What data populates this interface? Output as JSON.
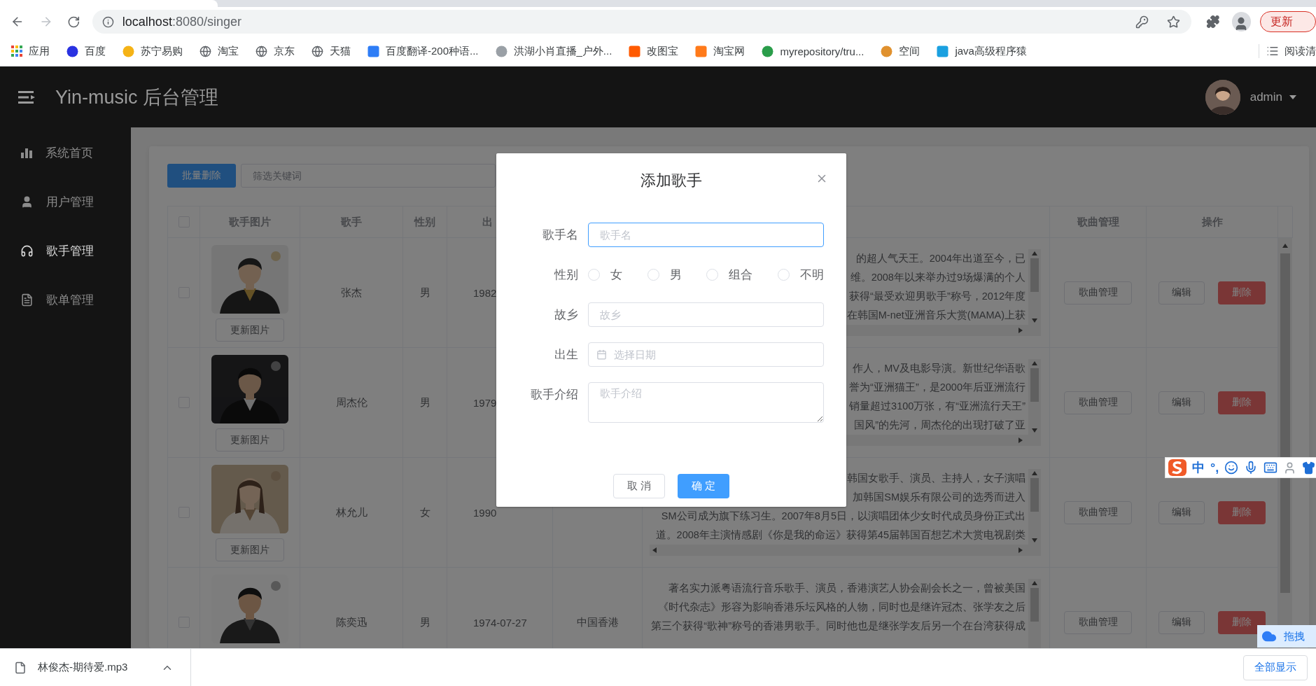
{
  "browser": {
    "url_host": "localhost",
    "url_path": ":8080/singer",
    "update_button": "更新",
    "bookmarks": [
      {
        "label": "应用",
        "kind": "apps"
      },
      {
        "label": "百度",
        "kind": "round",
        "color": "#2932e1"
      },
      {
        "label": "苏宁易购",
        "kind": "round",
        "color": "#f5b316"
      },
      {
        "label": "淘宝",
        "kind": "globe"
      },
      {
        "label": "京东",
        "kind": "globe"
      },
      {
        "label": "天猫",
        "kind": "globe"
      },
      {
        "label": "百度翻译-200种语...",
        "kind": "badge",
        "color": "#2e7df6"
      },
      {
        "label": "洪湖小肖直播_户外...",
        "kind": "round",
        "color": "#9aa0a6"
      },
      {
        "label": "改图宝",
        "kind": "badge",
        "color": "#ff5a00"
      },
      {
        "label": "淘宝网",
        "kind": "badge",
        "color": "#ff7a1a"
      },
      {
        "label": "myrepository/tru...",
        "kind": "round",
        "color": "#2a9d4a"
      },
      {
        "label": "空间",
        "kind": "round",
        "color": "#e0912e"
      },
      {
        "label": "java高级程序猿",
        "kind": "badge",
        "color": "#1aa0e0"
      }
    ],
    "reading_list": "阅读清"
  },
  "app": {
    "title": "Yin-music 后台管理",
    "user": "admin",
    "sidebar": [
      {
        "label": "系统首页",
        "kind": "chart",
        "selected": false
      },
      {
        "label": "用户管理",
        "kind": "user",
        "selected": false
      },
      {
        "label": "歌手管理",
        "kind": "headphones",
        "selected": true
      },
      {
        "label": "歌单管理",
        "kind": "document",
        "selected": false
      }
    ]
  },
  "content": {
    "batch_delete": "批量删除",
    "filter_placeholder": "筛选关键词",
    "table": {
      "header_checked": false,
      "columns": {
        "photo": "歌手图片",
        "name": "歌手",
        "sex": "性别",
        "birth": "出",
        "songs": "歌曲管理",
        "actions": "操作"
      },
      "rows": [
        {
          "checked": false,
          "update_photo": "更新图片",
          "name": "张杰",
          "sex": "男",
          "birth": "1982",
          "intro": [
            "的超人气天王。2004年出道至今，已",
            "维。2008年以来举办过9场爆满的个人",
            "获得“最受欢迎男歌手”称号，2012年度",
            "在韩国M-net亚洲音乐大赏(MAMA)上获"
          ],
          "songs": "歌曲管理",
          "edit": "编辑",
          "delete": "删除"
        },
        {
          "checked": false,
          "update_photo": "更新图片",
          "name": "周杰伦",
          "sex": "男",
          "birth": "1979",
          "intro": [
            "作人，MV及电影导演。新世纪华语歌",
            "誉为“亚洲猫王”，是2000年后亚洲流行",
            "销量超过3100万张，有“亚洲流行天王”",
            "国风”的先河，周杰伦的出现打破了亚"
          ],
          "songs": "歌曲管理",
          "edit": "编辑",
          "delete": "删除"
        },
        {
          "checked": false,
          "update_photo": "更新图片",
          "name": "林允儿",
          "sex": "女",
          "birth": "1990",
          "intro": [
            "韩国女歌手、演员、主持人，女子演唱",
            "加韩国SM娱乐有限公司的选秀而进入",
            "SM公司成为旗下练习生。2007年8月5日，以演唱团体少女时代成员身份正式出",
            "道。2008年主演情感剧《你是我的命运》获得第45届韩国百想艺术大赏电视剧类"
          ],
          "songs": "歌曲管理",
          "edit": "编辑",
          "delete": "删除"
        },
        {
          "checked": false,
          "name": "陈奕迅",
          "sex": "男",
          "birth": "1974-07-27",
          "region": "中国香港",
          "intro": [
            "著名实力派粤语流行音乐歌手、演员，香港演艺人协会副会长之一，曾被美国",
            "《时代杂志》形容为影响香港乐坛风格的人物，同时也是继许冠杰、张学友之后",
            "第三个获得“歌神”称号的香港男歌手。同时他也是继张学友后另一个在台湾获得成"
          ],
          "songs": "歌曲管理",
          "edit": "编辑",
          "delete": "删除"
        }
      ]
    }
  },
  "dialog": {
    "title": "添加歌手",
    "fields": [
      {
        "kind": "text",
        "label": "歌手名",
        "placeholder": "歌手名",
        "focused": true
      },
      {
        "kind": "radio",
        "label": "性别",
        "options": [
          {
            "label": "女",
            "selected": false
          },
          {
            "label": "男",
            "selected": false
          },
          {
            "label": "组合",
            "selected": false
          },
          {
            "label": "不明",
            "selected": false
          }
        ]
      },
      {
        "kind": "text",
        "label": "故乡",
        "placeholder": "故乡",
        "focused": false
      },
      {
        "kind": "date",
        "label": "出生",
        "placeholder": "选择日期",
        "focused": false
      },
      {
        "kind": "textarea",
        "label": "歌手介绍",
        "placeholder": "歌手介绍",
        "focused": false
      }
    ],
    "cancel": "取 消",
    "confirm": "确 定"
  },
  "ime": {
    "mode": "中",
    "punct": "°,"
  },
  "cloud_widget": {
    "label": "拖拽"
  },
  "download": {
    "file": "林俊杰-期待爱.mp3",
    "show_all": "全部显示"
  }
}
